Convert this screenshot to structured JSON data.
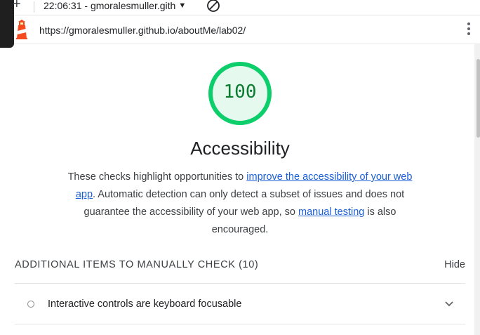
{
  "toolbar": {
    "report_label": "22:06:31 - gmoralesmuller.gith",
    "add_icon": "plus-icon",
    "clear_icon": "block-icon"
  },
  "url_bar": {
    "url": "https://gmoralesmuller.github.io/aboutMe/lab02/",
    "logo_icon": "lighthouse-logo",
    "menu_icon": "kebab-menu-icon"
  },
  "category": {
    "score": "100",
    "score_color": "#0cce6b",
    "title": "Accessibility",
    "description_part1": "These checks highlight opportunities to ",
    "description_link1": "improve the accessibility of your web app",
    "description_part2": ". Automatic detection can only detect a subset of issues and does not guarantee the accessibility of your web app, so ",
    "description_link2": "manual testing",
    "description_part3": " is also encouraged."
  },
  "manual_section": {
    "title": "ADDITIONAL ITEMS TO MANUALLY CHECK (10)",
    "toggle_label": "Hide",
    "items": [
      {
        "label": "Interactive controls are keyboard focusable"
      }
    ]
  }
}
